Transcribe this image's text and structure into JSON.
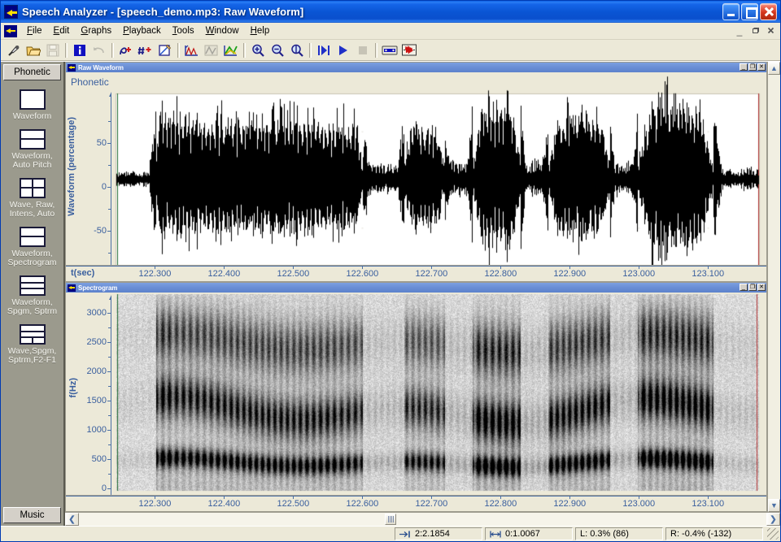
{
  "window": {
    "title": "Speech Analyzer - [speech_demo.mp3: Raw Waveform]",
    "app_name": "Speech Analyzer",
    "document_title": "speech_demo.mp3: Raw Waveform",
    "minimize": "_",
    "maximize": "□",
    "close": "✕"
  },
  "menu": {
    "items": [
      {
        "label": "File",
        "accel": "F"
      },
      {
        "label": "Edit",
        "accel": "E"
      },
      {
        "label": "Graphs",
        "accel": "G"
      },
      {
        "label": "Playback",
        "accel": "P"
      },
      {
        "label": "Tools",
        "accel": "T"
      },
      {
        "label": "Window",
        "accel": "W"
      },
      {
        "label": "Help",
        "accel": "H"
      }
    ],
    "mdi_buttons": [
      "minimize-child",
      "restore-child",
      "close-child"
    ]
  },
  "toolbar": {
    "buttons": [
      {
        "name": "record-icon",
        "tooltip": "Record"
      },
      {
        "name": "open-folder-icon",
        "tooltip": "Open"
      },
      {
        "name": "save-disk-icon",
        "tooltip": "Save"
      },
      {
        "name": "file-info-icon",
        "tooltip": "File Information"
      },
      {
        "name": "undo-icon",
        "tooltip": "Undo"
      },
      {
        "name": "add-phonetic-icon",
        "tooltip": "Add Phonetic Transcription"
      },
      {
        "name": "add-tone-icon",
        "tooltip": "Add Tone"
      },
      {
        "name": "edit-pencil-icon",
        "tooltip": "Edit"
      },
      {
        "name": "formant-chart-icon",
        "tooltip": "Formant Chart"
      },
      {
        "name": "spectrum-icon",
        "tooltip": "Spectrum"
      },
      {
        "name": "overlay-graph-icon",
        "tooltip": "Overlay"
      },
      {
        "name": "zoom-in-icon",
        "tooltip": "Zoom In"
      },
      {
        "name": "zoom-out-icon",
        "tooltip": "Zoom Out"
      },
      {
        "name": "zoom-full-icon",
        "tooltip": "Zoom Full"
      },
      {
        "name": "play-segment-icon",
        "tooltip": "Play Segment"
      },
      {
        "name": "play-icon",
        "tooltip": "Play"
      },
      {
        "name": "stop-icon",
        "tooltip": "Stop"
      },
      {
        "name": "player-icon",
        "tooltip": "Player"
      },
      {
        "name": "waveform-tool-icon",
        "tooltip": "Waveform Tool"
      }
    ]
  },
  "sidebar": {
    "header_label": "Phonetic",
    "footer_label": "Music",
    "items": [
      {
        "label": "Waveform",
        "glyph": "single"
      },
      {
        "label": "Waveform,\nAuto Pitch",
        "glyph": "two-row"
      },
      {
        "label": "Wave, Raw,\nIntens, Auto",
        "glyph": "quad"
      },
      {
        "label": "Waveform,\nSpectrogram",
        "glyph": "two-row"
      },
      {
        "label": "Waveform,\nSpgm, Sptrm",
        "glyph": "three-row"
      },
      {
        "label": "Wave,Spgm,\nSptrm,F2-F1",
        "glyph": "three-row-split"
      }
    ]
  },
  "panes": {
    "waveform": {
      "title": "Raw Waveform",
      "phonetic_label": "Phonetic",
      "y_title": "Waveform (percentage)",
      "y_ticks": [
        "50",
        "0",
        "-50"
      ],
      "x_title": "t(sec)",
      "buttons": [
        "_",
        "□",
        "✕"
      ]
    },
    "spectrogram": {
      "title": "Spectrogram",
      "y_title": "f(Hz)",
      "y_ticks": [
        "3000",
        "2500",
        "2000",
        "1500",
        "1000",
        "500",
        "0"
      ],
      "buttons": [
        "_",
        "□",
        "✕"
      ]
    },
    "x_ticks": [
      "122.300",
      "122.400",
      "122.500",
      "122.600",
      "122.700",
      "122.800",
      "122.900",
      "123.000",
      "123.100"
    ]
  },
  "scrollbars": {
    "up_arrow": "▲",
    "down_arrow": "▼",
    "left_arrow": "❮",
    "right_arrow": "❯"
  },
  "status_bar": {
    "cursor_position": "2:2.1854",
    "selection_length": "0:1.0067",
    "left_channel": "L: 0.3% (86)",
    "right_channel": "R: -0.4% (-132)"
  },
  "colors": {
    "title_blue": "#0a55d4",
    "face": "#ece9d8",
    "axis_blue": "#3a5f9e",
    "sidebar": "#9b9a8d",
    "cursor_green": "#1f6b2e",
    "cursor_red": "#b03030"
  },
  "chart_data": [
    {
      "type": "line",
      "name": "raw-waveform",
      "title": "Raw Waveform",
      "xlabel": "t(sec)",
      "ylabel": "Waveform (percentage)",
      "xlim": [
        122.243,
        123.175
      ],
      "ylim": [
        -100,
        100
      ],
      "yticks": [
        -50,
        0,
        50
      ],
      "xticks": [
        122.3,
        122.4,
        122.5,
        122.6,
        122.7,
        122.8,
        122.9,
        123.0,
        123.1
      ],
      "grid": false,
      "envelope_segments": [
        {
          "x_start": 122.243,
          "x_end": 122.3,
          "amplitude": 6
        },
        {
          "x_start": 122.3,
          "x_end": 122.32,
          "amplitude": 72
        },
        {
          "x_start": 122.32,
          "x_end": 122.56,
          "amplitude": 62
        },
        {
          "x_start": 122.56,
          "x_end": 122.6,
          "amplitude": 58
        },
        {
          "x_start": 122.6,
          "x_end": 122.66,
          "amplitude": 12
        },
        {
          "x_start": 122.66,
          "x_end": 122.72,
          "amplitude": 55
        },
        {
          "x_start": 122.72,
          "x_end": 122.76,
          "amplitude": 14
        },
        {
          "x_start": 122.76,
          "x_end": 122.83,
          "amplitude": 80
        },
        {
          "x_start": 122.83,
          "x_end": 122.87,
          "amplitude": 16
        },
        {
          "x_start": 122.87,
          "x_end": 122.96,
          "amplitude": 66
        },
        {
          "x_start": 122.96,
          "x_end": 123.0,
          "amplitude": 14
        },
        {
          "x_start": 123.0,
          "x_end": 123.11,
          "amplitude": 82
        },
        {
          "x_start": 123.11,
          "x_end": 123.175,
          "amplitude": 9
        }
      ]
    },
    {
      "type": "heatmap",
      "name": "spectrogram",
      "title": "Spectrogram",
      "xlabel": "t(sec)",
      "ylabel": "f(Hz)",
      "xlim": [
        122.243,
        123.175
      ],
      "ylim": [
        0,
        3200
      ],
      "yticks": [
        0,
        500,
        1000,
        1500,
        2000,
        2500,
        3000
      ],
      "xticks": [
        122.3,
        122.4,
        122.5,
        122.6,
        122.7,
        122.8,
        122.9,
        123.0,
        123.1
      ],
      "colormap": "grayscale-inverted",
      "formant_bands_hz": [
        450,
        1300,
        2400
      ]
    }
  ]
}
